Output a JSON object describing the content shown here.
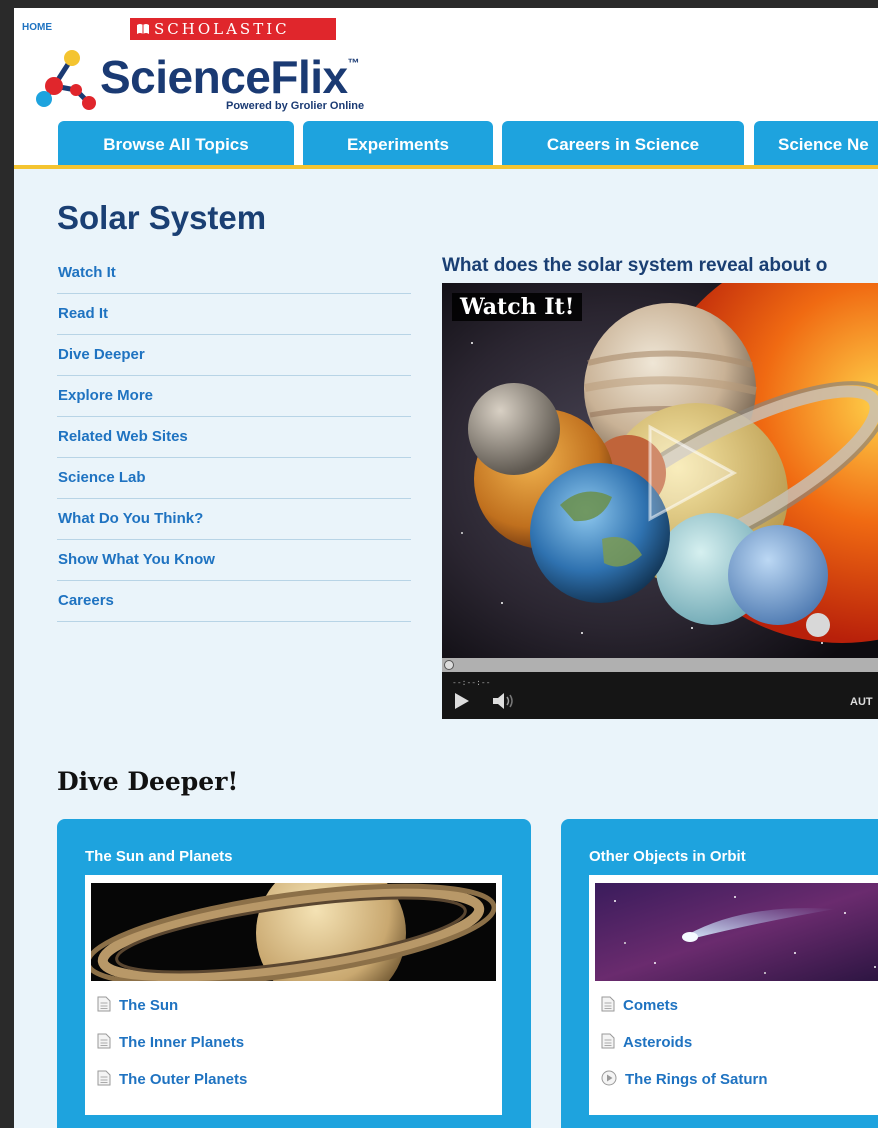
{
  "header": {
    "home_label": "HOME",
    "publisher": "SCHOLASTIC",
    "logo_text": "ScienceFlix",
    "logo_tm": "™",
    "powered_by": "Powered by Grolier Online"
  },
  "nav": {
    "tabs": [
      {
        "label": "Browse All Topics"
      },
      {
        "label": "Experiments"
      },
      {
        "label": "Careers in Science"
      },
      {
        "label": "Science Ne"
      }
    ]
  },
  "page": {
    "title": "Solar System",
    "question": "What does the solar system reveal about o"
  },
  "sidebar": {
    "items": [
      {
        "label": "Watch It"
      },
      {
        "label": "Read It"
      },
      {
        "label": "Dive Deeper"
      },
      {
        "label": "Explore More"
      },
      {
        "label": "Related Web Sites"
      },
      {
        "label": "Science Lab"
      },
      {
        "label": "What Do You Think?"
      },
      {
        "label": "Show What You Know"
      },
      {
        "label": "Careers"
      }
    ]
  },
  "video": {
    "overlay_label": "Watch It!",
    "timecode": "--:--:--",
    "auto_label": "AUT"
  },
  "dive_deeper": {
    "title": "Dive Deeper!",
    "cards": [
      {
        "title": "The Sun and Planets",
        "links": [
          {
            "label": "The Sun",
            "icon": "document-icon"
          },
          {
            "label": "The Inner Planets",
            "icon": "document-icon"
          },
          {
            "label": "The Outer Planets",
            "icon": "document-icon"
          }
        ]
      },
      {
        "title": "Other Objects in Orbit",
        "links": [
          {
            "label": "Comets",
            "icon": "document-icon"
          },
          {
            "label": "Asteroids",
            "icon": "document-icon"
          },
          {
            "label": "The Rings of Saturn",
            "icon": "play-circle-icon"
          }
        ]
      }
    ]
  },
  "colors": {
    "accent_blue": "#1ea3de",
    "title_navy": "#1a3f73",
    "link_blue": "#1f73c1",
    "nav_underline": "#f4c430",
    "brand_red": "#e0262c"
  }
}
